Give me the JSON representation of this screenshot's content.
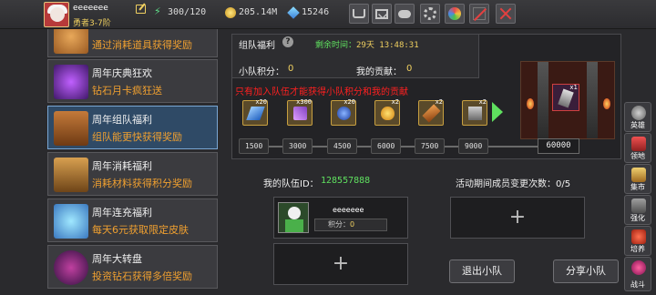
{
  "player": {
    "name": "eeeeeee",
    "level": "勇者3-7阶"
  },
  "resources": {
    "energy": "300/120",
    "gold": "205.14M",
    "gems": "15246"
  },
  "toolbar": [
    "shop-cart-icon",
    "mail-icon",
    "gamepad-icon",
    "settings-gear-icon",
    "lucky-wheel-icon",
    "disabled-icon",
    "close-icon"
  ],
  "activities": [
    {
      "title": "",
      "desc": "通过消耗道具获得奖励"
    },
    {
      "title": "周年庆典狂欢",
      "desc": "钻石月卡疯狂送"
    },
    {
      "title": "周年组队福利",
      "desc": "组队能更快获得奖励"
    },
    {
      "title": "周年消耗福利",
      "desc": "消耗材料获得积分奖励"
    },
    {
      "title": "周年连充福利",
      "desc": "每天6元获取限定皮肤"
    },
    {
      "title": "周年大转盘",
      "desc": "投资钻石获得多倍奖励"
    }
  ],
  "team_panel": {
    "title": "组队福利",
    "help": "?",
    "remain_label": "剩余时间：",
    "remain_value": "29天 13:48:31",
    "score_label": "小队积分：",
    "score_value": "0",
    "contrib_label": "我的贡献：",
    "contrib_value": "0",
    "notice": "只有加入队伍才能获得小队积分和我的贡献",
    "rewards": [
      {
        "icon": "lightning-scroll-icon",
        "count": "x20"
      },
      {
        "icon": "magic-staff-icon",
        "count": "x300"
      },
      {
        "icon": "blue-orb-icon",
        "count": "x20"
      },
      {
        "icon": "golden-egg-icon",
        "count": "x2"
      },
      {
        "icon": "wand-icon",
        "count": "x2"
      },
      {
        "icon": "hammer-icon",
        "count": "x2"
      }
    ],
    "boss_reward": {
      "icon": "sword-icon",
      "count": "x1"
    },
    "milestones": [
      "1500",
      "3000",
      "4500",
      "6000",
      "7500",
      "9000"
    ],
    "final_milestone": "60000"
  },
  "team": {
    "id_label": "我的队伍ID：",
    "id_value": "128557888",
    "changes_label": "活动期间成员变更次数：",
    "changes_value": "0/5",
    "member": {
      "name": "eeeeeee",
      "score_label": "积分：",
      "score_value": "0"
    },
    "add_symbol": "+",
    "leave_button": "退出小队",
    "share_button": "分享小队"
  },
  "side_nav": [
    "英雄",
    "领地",
    "集市",
    "强化",
    "培养",
    "战斗"
  ]
}
